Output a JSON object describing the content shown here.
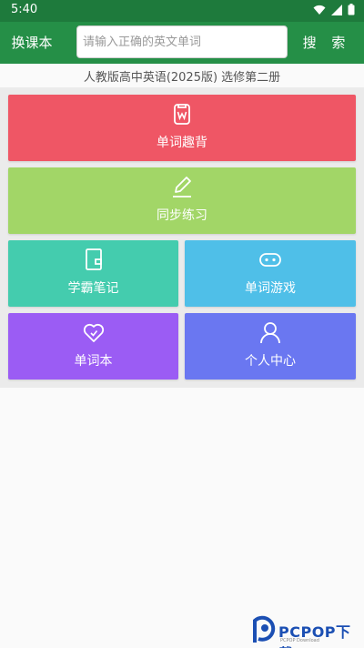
{
  "status_bar": {
    "time": "5:40"
  },
  "toolbar": {
    "switch_label": "换课本",
    "search_placeholder": "请输入正确的英文单词",
    "search_value": "",
    "search_label": "搜 索"
  },
  "edition": "人教版高中英语(2025版) 选修第二册",
  "tiles": [
    {
      "label": "单词趣背",
      "icon": "shirt-w-icon",
      "color": "#ef5665"
    },
    {
      "label": "同步练习",
      "icon": "pencil-icon",
      "color": "#a2d667"
    },
    {
      "label": "学霸笔记",
      "icon": "notebook-icon",
      "color": "#44ccae"
    },
    {
      "label": "单词游戏",
      "icon": "gamepad-icon",
      "color": "#4fbfe8"
    },
    {
      "label": "单词本",
      "icon": "heart-check-icon",
      "color": "#9b5cf4"
    },
    {
      "label": "个人中心",
      "icon": "user-icon",
      "color": "#6a77f1"
    }
  ],
  "watermark": {
    "title": "PCPOP下载",
    "subtitle": "PCPOP Download"
  }
}
